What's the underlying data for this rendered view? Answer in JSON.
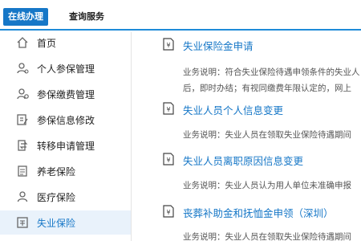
{
  "tabs": {
    "active": "在线办理",
    "other": "查询服务"
  },
  "sidebar": {
    "items": [
      {
        "label": "首页",
        "icon": "home-icon"
      },
      {
        "label": "个人参保管理",
        "icon": "person-icon"
      },
      {
        "label": "参保缴费管理",
        "icon": "person-gear-icon"
      },
      {
        "label": "参保信息修改",
        "icon": "edit-document-icon"
      },
      {
        "label": "转移申请管理",
        "icon": "transfer-icon"
      },
      {
        "label": "养老保险",
        "icon": "document-icon"
      },
      {
        "label": "医疗保险",
        "icon": "user-icon"
      },
      {
        "label": "失业保险",
        "icon": "unemployment-doc-icon"
      }
    ],
    "active_index": 7
  },
  "services": [
    {
      "title": "失业保险金申请",
      "desc_lines": [
        "业务说明：符合失业保险待遇申领条件的失业人",
        "后，即时办结；有视同缴费年限认定的，网上"
      ]
    },
    {
      "title": "失业人员个人信息变更",
      "desc_lines": [
        "业务说明：失业人员在领取失业保险待遇期间"
      ]
    },
    {
      "title": "失业人员离职原因信息变更",
      "desc_lines": [
        "业务说明：失业人员认为用人单位未准确申报"
      ]
    },
    {
      "title": "丧葬补助金和抚恤金申领（深圳）",
      "desc_lines": [
        "业务说明：失业人员在领取失业保险待遇期间"
      ]
    }
  ],
  "doc_icon_symbol": "¥",
  "colors": {
    "accent": "#1677c7",
    "active_bg": "#e9f2fb"
  }
}
